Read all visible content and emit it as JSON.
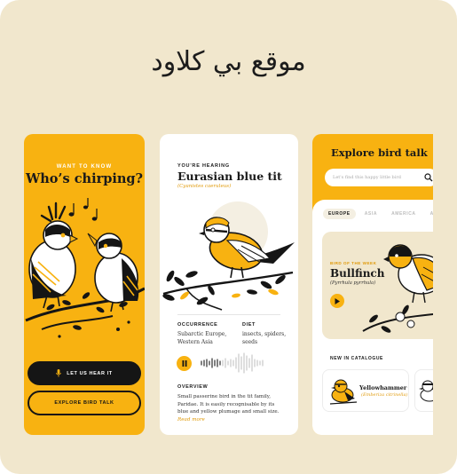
{
  "headline": "موقع بي كلاود",
  "colors": {
    "background": "#f1e7cd",
    "accent": "#f8b211",
    "dark": "#151515",
    "highlight_text": "#e09a0a"
  },
  "screen1": {
    "kicker": "WANT TO KNOW",
    "title": "Who’s chirping?",
    "primary_button": "LET US HEAR IT",
    "primary_button_icon": "microphone-icon",
    "secondary_button": "EXPLORE BIRD TALK"
  },
  "screen2": {
    "kicker": "YOU'RE HEARING",
    "title": "Eurasian blue tit",
    "latin": "(Cyanistes caeruleus)",
    "occurrence_label": "OCCURRENCE",
    "occurrence_lines": [
      "Subarctic Europe,",
      "Western Asia"
    ],
    "diet_label": "DIET",
    "diet_lines": [
      "insects, spiders,",
      "seeds"
    ],
    "player_icon": "pause-icon",
    "overview_label": "OVERVIEW",
    "overview_text": "Small passerine bird in the tit family, Paridae. It is easily recognisable by its blue and yellow plumage and small size.",
    "read_more": "Read more"
  },
  "screen3": {
    "title": "Explore bird talk",
    "search_placeholder": "Let's find this happy little bird",
    "tabs": [
      {
        "label": "EUROPE",
        "active": true
      },
      {
        "label": "ASIA",
        "active": false
      },
      {
        "label": "AMERICA",
        "active": false
      },
      {
        "label": "AFRICA",
        "active": false
      }
    ],
    "featured_kicker": "BIRD OF THE WEEK",
    "featured_title": "Bullfinch",
    "featured_latin": "(Pyrrhula pyrrhula)",
    "featured_icon": "play-icon",
    "catalogue_label": "NEW IN CATALOGUE",
    "catalogue_item_title": "Yellowhammer",
    "catalogue_item_latin": "(Emberiza citrinella)"
  }
}
